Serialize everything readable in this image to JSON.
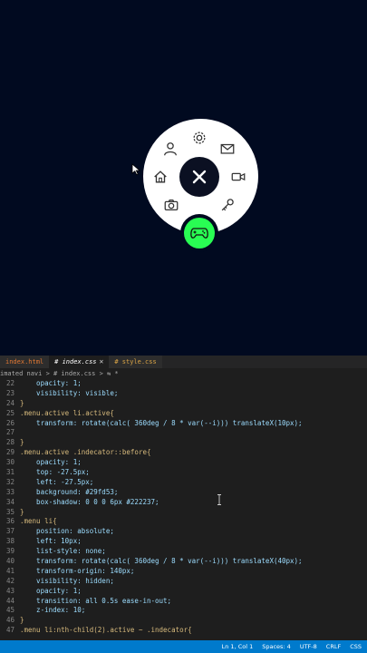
{
  "colors": {
    "page_bg": "#010a20",
    "menu_bg": "#ffffff",
    "accent": "#29fd53",
    "editor_bg": "#1e1e1e",
    "status_bg": "#007acc"
  },
  "menu": {
    "toggle_icon": "close-icon",
    "items": [
      "user-icon",
      "gear-icon",
      "mail-icon",
      "video-icon",
      "key-icon",
      "gamepad-icon",
      "camera-icon",
      "home-icon"
    ],
    "active_item": "gamepad-icon"
  },
  "tabs": [
    {
      "label": "index.html",
      "active": false
    },
    {
      "label": "# index.css",
      "active": true,
      "close": "✕"
    },
    {
      "label": "# style.css",
      "active": false
    }
  ],
  "breadcrumb": "imated navi > # index.css > ⇆ *",
  "code": [
    {
      "n": "22",
      "t": "    opacity: 1;"
    },
    {
      "n": "23",
      "t": "    visibility: visible;"
    },
    {
      "n": "24",
      "t": "}"
    },
    {
      "n": "25",
      "t": ".menu.active li.active{"
    },
    {
      "n": "26",
      "t": "    transform: rotate(calc( 360deg / 8 * var(--i))) translateX(10px);"
    },
    {
      "n": "27",
      "t": ""
    },
    {
      "n": "28",
      "t": "}"
    },
    {
      "n": "29",
      "t": ".menu.active .indecator::before{"
    },
    {
      "n": "30",
      "t": "    opacity: 1;"
    },
    {
      "n": "31",
      "t": "    top: -27.5px;"
    },
    {
      "n": "32",
      "t": "    left: -27.5px;"
    },
    {
      "n": "33",
      "t": "    background: #29fd53;"
    },
    {
      "n": "34",
      "t": "    box-shadow: 0 0 0 6px #222237;"
    },
    {
      "n": "35",
      "t": "}"
    },
    {
      "n": "36",
      "t": ".menu li{"
    },
    {
      "n": "37",
      "t": "    position: absolute;"
    },
    {
      "n": "38",
      "t": "    left: 10px;"
    },
    {
      "n": "39",
      "t": "    list-style: none;"
    },
    {
      "n": "40",
      "t": "    transform: rotate(calc( 360deg / 8 * var(--i))) translateX(40px);"
    },
    {
      "n": "41",
      "t": "    transform-origin: 140px;"
    },
    {
      "n": "42",
      "t": "    visibility: hidden;"
    },
    {
      "n": "43",
      "t": "    opacity: 1;"
    },
    {
      "n": "44",
      "t": "    transition: all 0.5s ease-in-out;"
    },
    {
      "n": "45",
      "t": "    z-index: 10;"
    },
    {
      "n": "46",
      "t": "}"
    },
    {
      "n": "47",
      "t": ".menu li:nth-child(2).active ~ .indecator{"
    }
  ],
  "status": {
    "position": "Ln 1, Col 1",
    "spaces": "Spaces: 4",
    "encoding": "UTF-8",
    "eol": "CRLF",
    "language": "CSS"
  }
}
